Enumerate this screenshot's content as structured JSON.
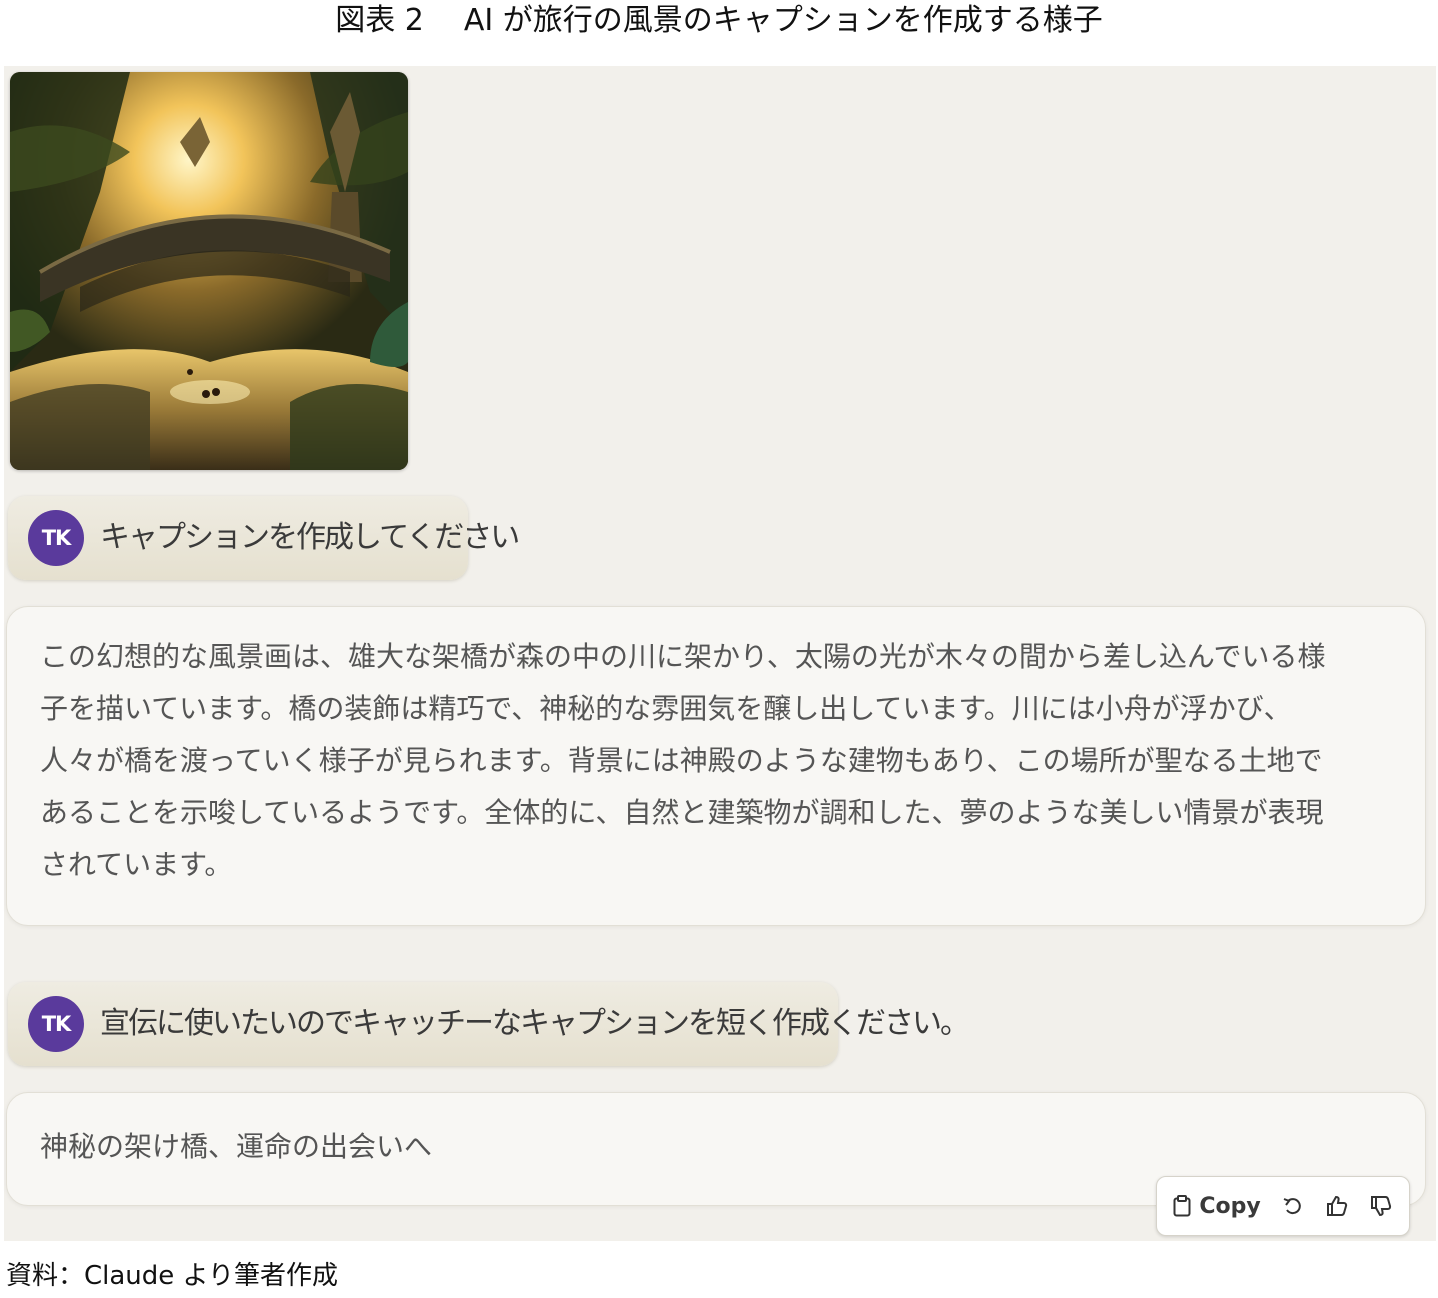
{
  "figure": {
    "label": "図表 2",
    "title": "AI が旅行の風景のキャプションを作成する様子"
  },
  "conversation": {
    "user_avatar_initials": "TK",
    "uploaded_image_alt": "幻想的な風景画",
    "messages": [
      {
        "role": "user",
        "text": "キャプションを作成してください"
      },
      {
        "role": "assistant",
        "text": "この幻想的な風景画は、雄大な架橋が森の中の川に架かり、太陽の光が木々の間から差し込んでいる様子を描いています。橋の装飾は精巧で、神秘的な雰囲気を醸し出しています。川には小舟が浮かび、人々が橋を渡っていく様子が見られます。背景には神殿のような建物もあり、この場所が聖なる土地であることを示唆しているようです。全体的に、自然と建築物が調和した、夢のような美しい情景が表現されています。"
      },
      {
        "role": "user",
        "text": "宣伝に使いたいのでキャッチーなキャプションを短く作成ください。"
      },
      {
        "role": "assistant",
        "text": "神秘の架け橋、運命の出会いへ"
      }
    ]
  },
  "actions": {
    "copy_label": "Copy",
    "icons": [
      "clipboard-icon",
      "retry-icon",
      "thumbs-up-icon",
      "thumbs-down-icon"
    ]
  },
  "source_note": "資料：Claude より筆者作成",
  "colors": {
    "background": "#f2f0eb",
    "avatar": "#5a3a9c",
    "user_bubble": "#e8e4d6",
    "assistant_bubble": "#f8f7f4"
  }
}
